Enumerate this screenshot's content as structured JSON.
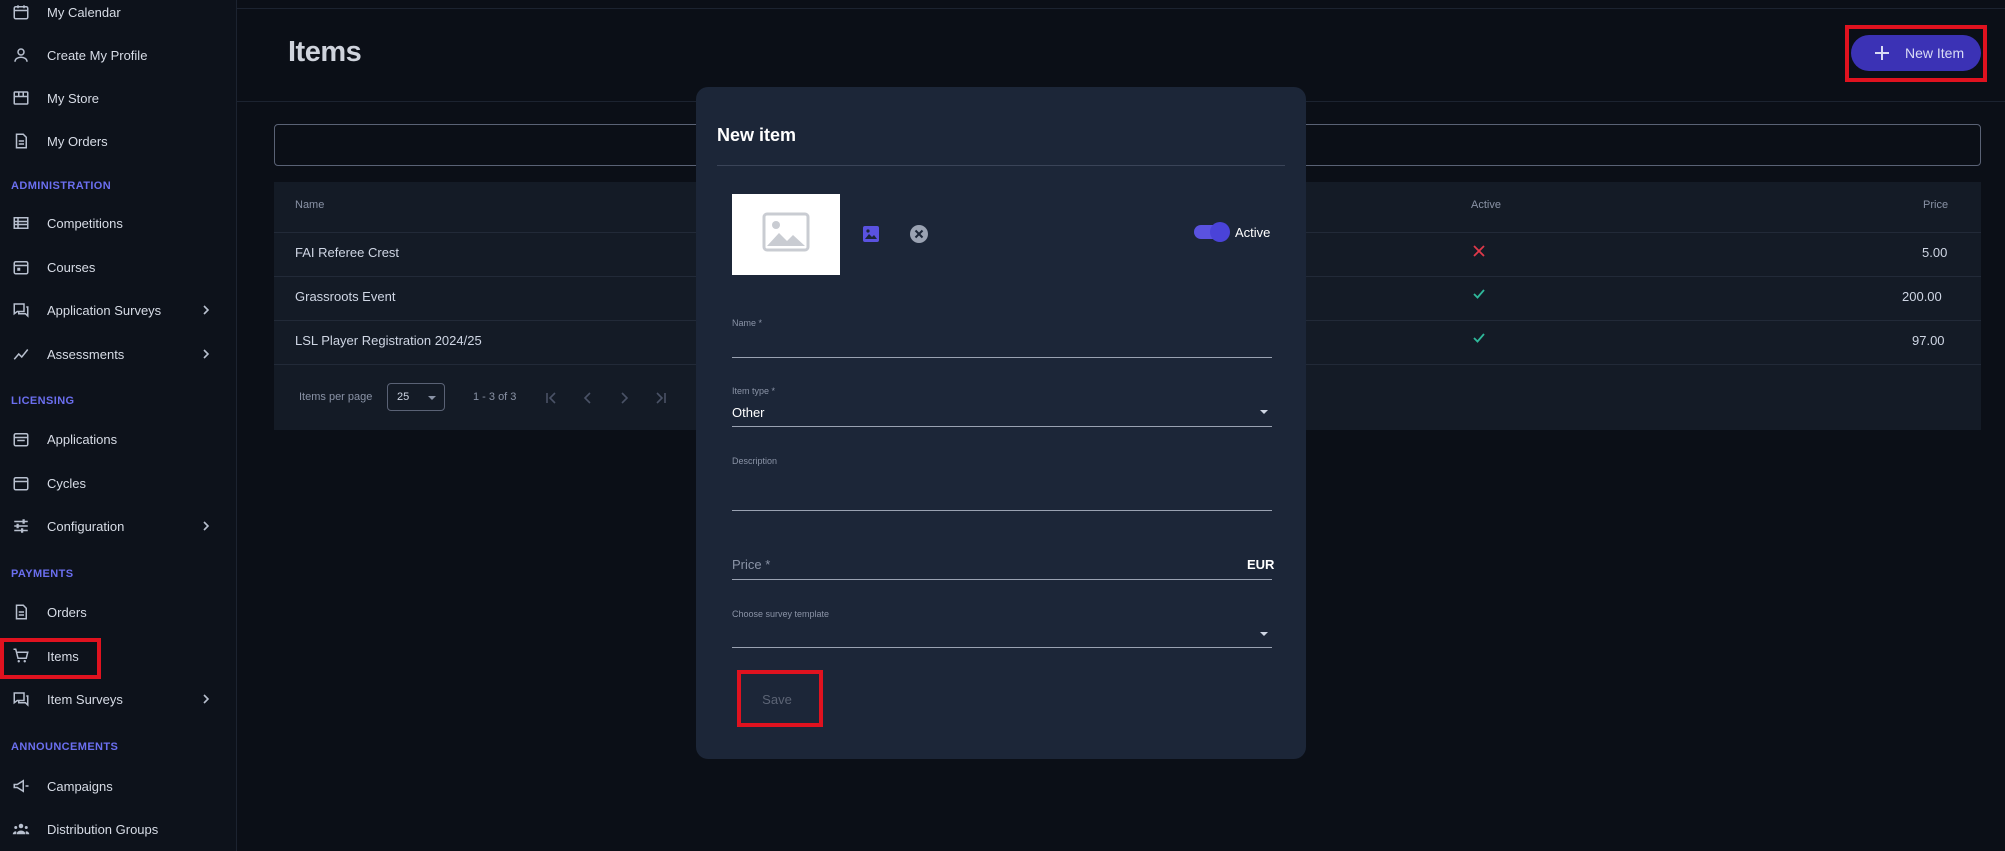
{
  "sidebar": {
    "items": [
      {
        "label": "My Calendar",
        "icon": "calendar-icon"
      },
      {
        "label": "Create My Profile",
        "icon": "person-icon"
      },
      {
        "label": "My Store",
        "icon": "store-icon"
      },
      {
        "label": "My Orders",
        "icon": "receipt-icon"
      },
      {
        "label": "Competitions",
        "icon": "list-icon"
      },
      {
        "label": "Courses",
        "icon": "calendar-icon"
      },
      {
        "label": "Application Surveys",
        "icon": "forum-icon"
      },
      {
        "label": "Assessments",
        "icon": "trend-icon"
      },
      {
        "label": "Applications",
        "icon": "calendar-icon"
      },
      {
        "label": "Cycles",
        "icon": "calendar-icon"
      },
      {
        "label": "Configuration",
        "icon": "tune-icon"
      },
      {
        "label": "Orders",
        "icon": "receipt-icon"
      },
      {
        "label": "Items",
        "icon": "cart-icon"
      },
      {
        "label": "Item Surveys",
        "icon": "forum-icon"
      },
      {
        "label": "Campaigns",
        "icon": "megaphone-icon"
      },
      {
        "label": "Distribution Groups",
        "icon": "groups-icon"
      }
    ],
    "sections": [
      "ADMINISTRATION",
      "LICENSING",
      "PAYMENTS",
      "ANNOUNCEMENTS"
    ]
  },
  "header": {
    "title": "Items",
    "new_button": "New Item"
  },
  "table": {
    "columns": {
      "name": "Name",
      "active": "Active",
      "price": "Price"
    },
    "rows": [
      {
        "name": "FAI Referee Crest",
        "active": false,
        "price": "5.00"
      },
      {
        "name": "Grassroots Event",
        "active": true,
        "price": "200.00"
      },
      {
        "name": "LSL Player Registration 2024/25",
        "active": true,
        "price": "97.00"
      }
    ],
    "paginator": {
      "items_per_page_label": "Items per page",
      "items_per_page": "25",
      "range": "1 - 3 of 3"
    }
  },
  "dialog": {
    "title": "New item",
    "active_label": "Active",
    "active": true,
    "fields": {
      "name_label": "Name *",
      "item_type_label": "Item type *",
      "item_type_value": "Other",
      "description_label": "Description",
      "price_placeholder": "Price *",
      "price_suffix": "EUR",
      "survey_label": "Choose survey template"
    },
    "save_label": "Save"
  },
  "colors": {
    "accent": "#3b32b5",
    "section": "#6b6ff0",
    "highlight": "#e0121f",
    "active_true": "#2fb89a",
    "active_false": "#e0394a"
  }
}
